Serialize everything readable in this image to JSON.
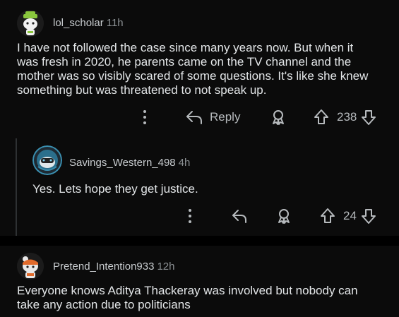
{
  "comments": [
    {
      "username": "lol_scholar",
      "age": "11h",
      "body_lines": [
        "I have not followed the case since many years now. But when it",
        "was fresh in 2020, he parents came on the TV channel and the",
        "mother was so visibly scared of some questions.  It's like she knew",
        "something but was threatened to not speak up."
      ],
      "reply_label": "Reply",
      "vote_count": "238",
      "avatar_color": "#8ac73d"
    },
    {
      "username": "Savings_Western_498",
      "age": "4h",
      "body_lines": [
        "Yes. Lets hope they get justice."
      ],
      "vote_count": "24",
      "avatar_color": "#3a8fb0"
    },
    {
      "username": "Pretend_Intention933",
      "age": "12h",
      "body_lines": [
        "Everyone knows Aditya Thackeray was involved but nobody can",
        "take any action due to politicians"
      ],
      "avatar_color": "#e8e8e8"
    }
  ],
  "icons": {
    "more": "more-vertical-icon",
    "reply": "reply-arrow-icon",
    "award": "award-icon",
    "upvote": "upvote-arrow-icon",
    "downvote": "downvote-arrow-icon"
  }
}
